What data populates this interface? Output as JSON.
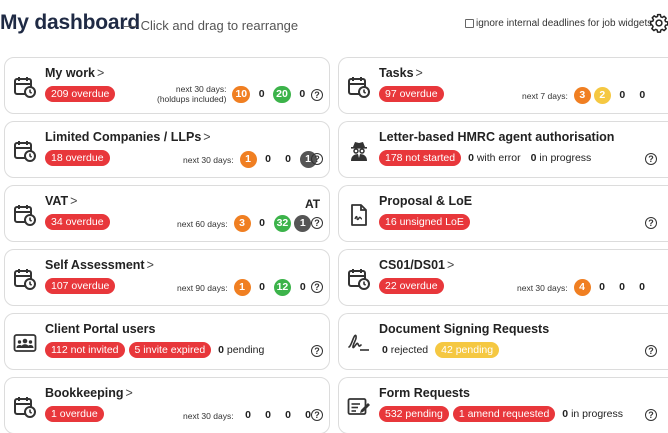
{
  "header": {
    "title": "My dashboard",
    "subtitle": "— Click and drag to rearrange",
    "ignore_label": "ignore internal deadlines for job widgets"
  },
  "cards": {
    "my_work": {
      "title": "My work",
      "badge": "209 overdue",
      "period_line1": "next 30 days:",
      "period_line2": "(holdups included)",
      "counts": [
        "10",
        "0",
        "20",
        "0"
      ]
    },
    "tasks": {
      "title": "Tasks",
      "badge": "97 overdue",
      "period": "next 7 days:",
      "counts": [
        "3",
        "2",
        "0",
        "0"
      ]
    },
    "limited": {
      "title": "Limited Companies / LLPs",
      "badge": "18 overdue",
      "period": "next 30 days:",
      "counts": [
        "1",
        "0",
        "0",
        "1"
      ]
    },
    "hmrc": {
      "title": "Letter-based HMRC agent authorisation",
      "badge": "178 not started",
      "s1": "0",
      "s1_label": "with error",
      "s2": "0",
      "s2_label": "in progress"
    },
    "vat": {
      "title": "VAT",
      "badge": "34 overdue",
      "period": "next 60 days:",
      "counts": [
        "3",
        "0",
        "32",
        "1"
      ],
      "at": "AT"
    },
    "proposal": {
      "title": "Proposal & LoE",
      "badge": "16 unsigned LoE"
    },
    "self_assessment": {
      "title": "Self Assessment",
      "badge": "107 overdue",
      "period": "next 90 days:",
      "counts": [
        "1",
        "0",
        "12",
        "0"
      ]
    },
    "cs01": {
      "title": "CS01/DS01",
      "badge": "22 overdue",
      "period": "next 30 days:",
      "counts": [
        "4",
        "0",
        "0",
        "0"
      ]
    },
    "portal": {
      "title": "Client Portal users",
      "badge1": "112 not invited",
      "badge2": "5 invite expired",
      "s1": "0",
      "s1_label": "pending"
    },
    "doc_signing": {
      "title": "Document Signing Requests",
      "s1": "0",
      "s1_label": "rejected",
      "badge": "42 pending"
    },
    "bookkeeping": {
      "title": "Bookkeeping",
      "badge": "1 overdue",
      "period": "next 30 days:",
      "counts": [
        "0",
        "0",
        "0",
        "0"
      ]
    },
    "form_requests": {
      "title": "Form Requests",
      "badge1": "532 pending",
      "badge2": "1 amend requested",
      "s1": "0",
      "s1_label": "in progress"
    }
  },
  "chevron": ">",
  "help_glyph": "?",
  "colors": {
    "red": "#e8373b",
    "orange": "#f07f22",
    "green": "#3cb34a",
    "yellow": "#f5c842",
    "dark": "#555555"
  }
}
